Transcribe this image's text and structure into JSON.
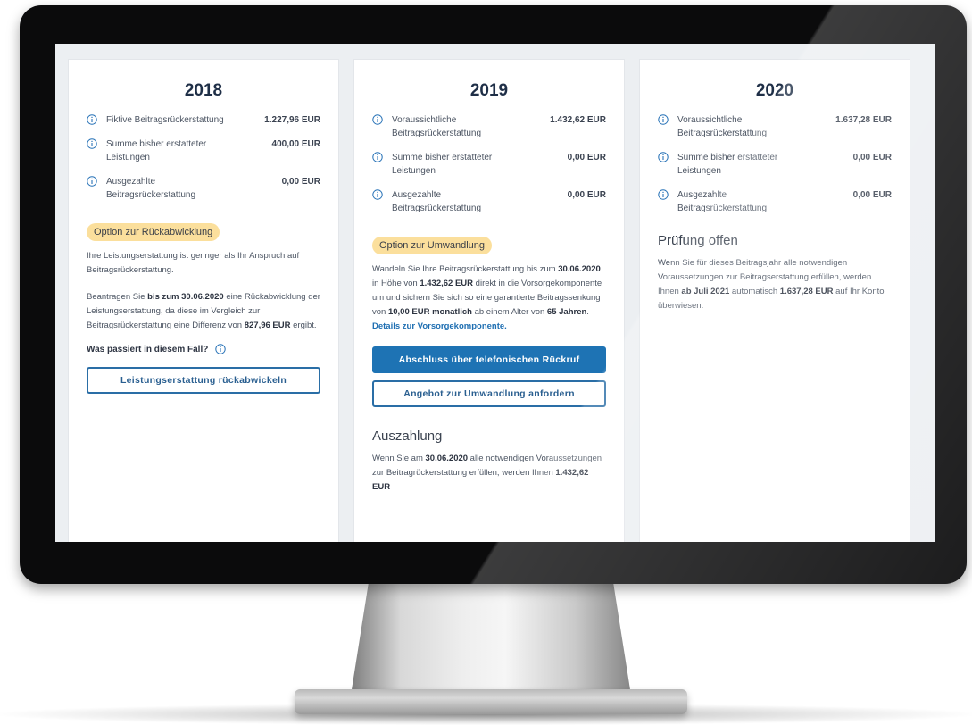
{
  "columns": [
    {
      "year": "2018",
      "stats": [
        {
          "label": "Fiktive Beitragsrückerstattung",
          "value": "1.227,96 EUR"
        },
        {
          "label": "Summe bisher erstatteter Leistungen",
          "value": "400,00 EUR"
        },
        {
          "label": "Ausgezahlte Beitragsrückerstattung",
          "value": "0,00 EUR"
        }
      ],
      "badge": "Option zur Rückabwicklung",
      "para1": "Ihre Leistungserstattung ist geringer als Ihr Anspruch auf Beitragsrückerstattung.",
      "para2": {
        "t1": "Beantragen Sie ",
        "b1": "bis zum 30.06.2020",
        "t2": " eine Rückabwicklung der Leistungserstattung, da diese im Vergleich zur Beitragsrückerstattung eine Differenz von ",
        "b2": "827,96 EUR",
        "t3": " ergibt."
      },
      "question": "Was passiert in diesem Fall?",
      "button": "Leistungserstattung rückabwickeln"
    },
    {
      "year": "2019",
      "stats": [
        {
          "label": "Voraussichtliche Beitragsrückerstattung",
          "value": "1.432,62 EUR"
        },
        {
          "label": "Summe bisher erstatteter Leistungen",
          "value": "0,00 EUR"
        },
        {
          "label": "Ausgezahlte Beitragsrückerstattung",
          "value": "0,00 EUR"
        }
      ],
      "badge": "Option zur Umwandlung",
      "para": {
        "t1": "Wandeln Sie Ihre Beitragsrückerstattung bis zum ",
        "b1": "30.06.2020",
        "t2": " in Höhe von ",
        "b2": "1.432,62 EUR",
        "t3": " direkt in die Vorsorgekomponente um und sichern Sie sich so eine garantierte Beitragssenkung von ",
        "b3": "10,00 EUR monatlich",
        "t4": " ab einem Alter von ",
        "b4": "65 Jahren",
        "t5": ".",
        "link": "Details zur Vorsorgekomponente."
      },
      "button_primary": "Abschluss über telefonischen Rückruf",
      "button_secondary": "Angebot zur Umwandlung anfordern",
      "section_title": "Auszahlung",
      "para2": {
        "t1": "Wenn Sie am ",
        "b1": "30.06.2020",
        "t2": " alle notwendigen Voraussetzungen zur Beitragrückerstattung erfüllen, werden Ihnen ",
        "b2": "1.432,62 EUR"
      }
    },
    {
      "year": "2020",
      "stats": [
        {
          "label": "Voraussichtliche Beitragsrückerstattung",
          "value": "1.637,28 EUR"
        },
        {
          "label": "Summe bisher erstatteter Leistungen",
          "value": "0,00 EUR"
        },
        {
          "label": "Ausgezahlte Beitragsrückerstattung",
          "value": "0,00 EUR"
        }
      ],
      "section_title": "Prüfung offen",
      "para": {
        "t1": "Wenn Sie für dieses Beitragsjahr alle notwendigen Voraussetzungen zur Beitragserstattung erfüllen, werden Ihnen ",
        "b1": "ab Juli 2021",
        "t2": " automatisch ",
        "b2": "1.637,28 EUR",
        "t3": " auf Ihr Konto überwiesen."
      }
    }
  ],
  "icons": {
    "info": "info-circle-icon"
  },
  "colors": {
    "accent": "#1e73b4",
    "badge": "#fbdf9c",
    "year_text": "#1f2f47"
  }
}
